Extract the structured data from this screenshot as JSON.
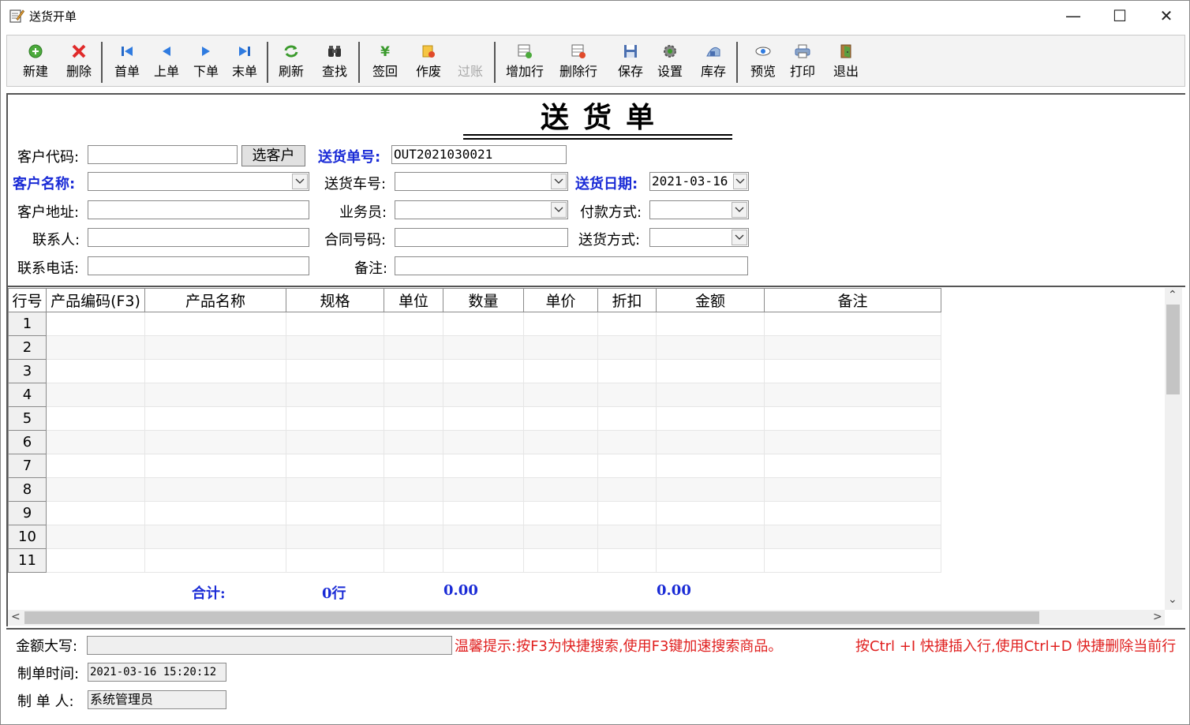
{
  "window": {
    "title": "送货开单",
    "minimize": "—",
    "maximize": "☐",
    "close": "✕"
  },
  "toolbar": {
    "new": "新建",
    "delete": "删除",
    "first": "首单",
    "prev": "上单",
    "next": "下单",
    "last": "末单",
    "refresh": "刷新",
    "find": "查找",
    "sign_back": "签回",
    "void": "作废",
    "post": "过账",
    "add_row": "增加行",
    "del_row": "删除行",
    "save": "保存",
    "settings": "设置",
    "stock": "库存",
    "preview": "预览",
    "print": "打印",
    "exit": "退出"
  },
  "form": {
    "doc_title": "送货单",
    "customer_code_label": "客户代码:",
    "customer_code": "",
    "select_customer": "选客户",
    "order_no_label": "送货单号:",
    "order_no": "OUT2021030021",
    "customer_name_label": "客户名称:",
    "customer_name": "",
    "vehicle_label": "送货车号:",
    "vehicle": "",
    "delivery_date_label": "送货日期:",
    "delivery_date": "2021-03-16",
    "address_label": "客户地址:",
    "address": "",
    "salesman_label": "业务员:",
    "salesman": "",
    "payment_label": "付款方式:",
    "payment": "",
    "contact_label": "联系人:",
    "contact": "",
    "contract_label": "合同号码:",
    "contract": "",
    "delivery_method_label": "送货方式:",
    "delivery_method": "",
    "phone_label": "联系电话:",
    "phone": "",
    "remark_label": "备注:",
    "remark": ""
  },
  "grid": {
    "columns": [
      "行号",
      "产品编码(F3)",
      "产品名称",
      "规格",
      "单位",
      "数量",
      "单价",
      "折扣",
      "金额",
      "备注"
    ],
    "rows": [
      "1",
      "2",
      "3",
      "4",
      "5",
      "6",
      "7",
      "8",
      "9",
      "10",
      "11"
    ]
  },
  "totals": {
    "label": "合计:",
    "rows": "0行",
    "qty": "0.00",
    "amount": "0.00"
  },
  "bottom": {
    "amount_words_label": "金额大写:",
    "amount_words": "",
    "tip1": "温馨提示:按F3为快捷搜索,使用F3键加速搜索商品。",
    "tip2": "按Ctrl +I 快捷插入行,使用Ctrl+D 快捷删除当前行",
    "created_time_label": "制单时间:",
    "created_time": "2021-03-16 15:20:12",
    "creator_label": "制 单 人:",
    "creator": "系统管理员"
  },
  "colors": {
    "required_label": "#1a2bd6",
    "tip": "#e0201f"
  }
}
